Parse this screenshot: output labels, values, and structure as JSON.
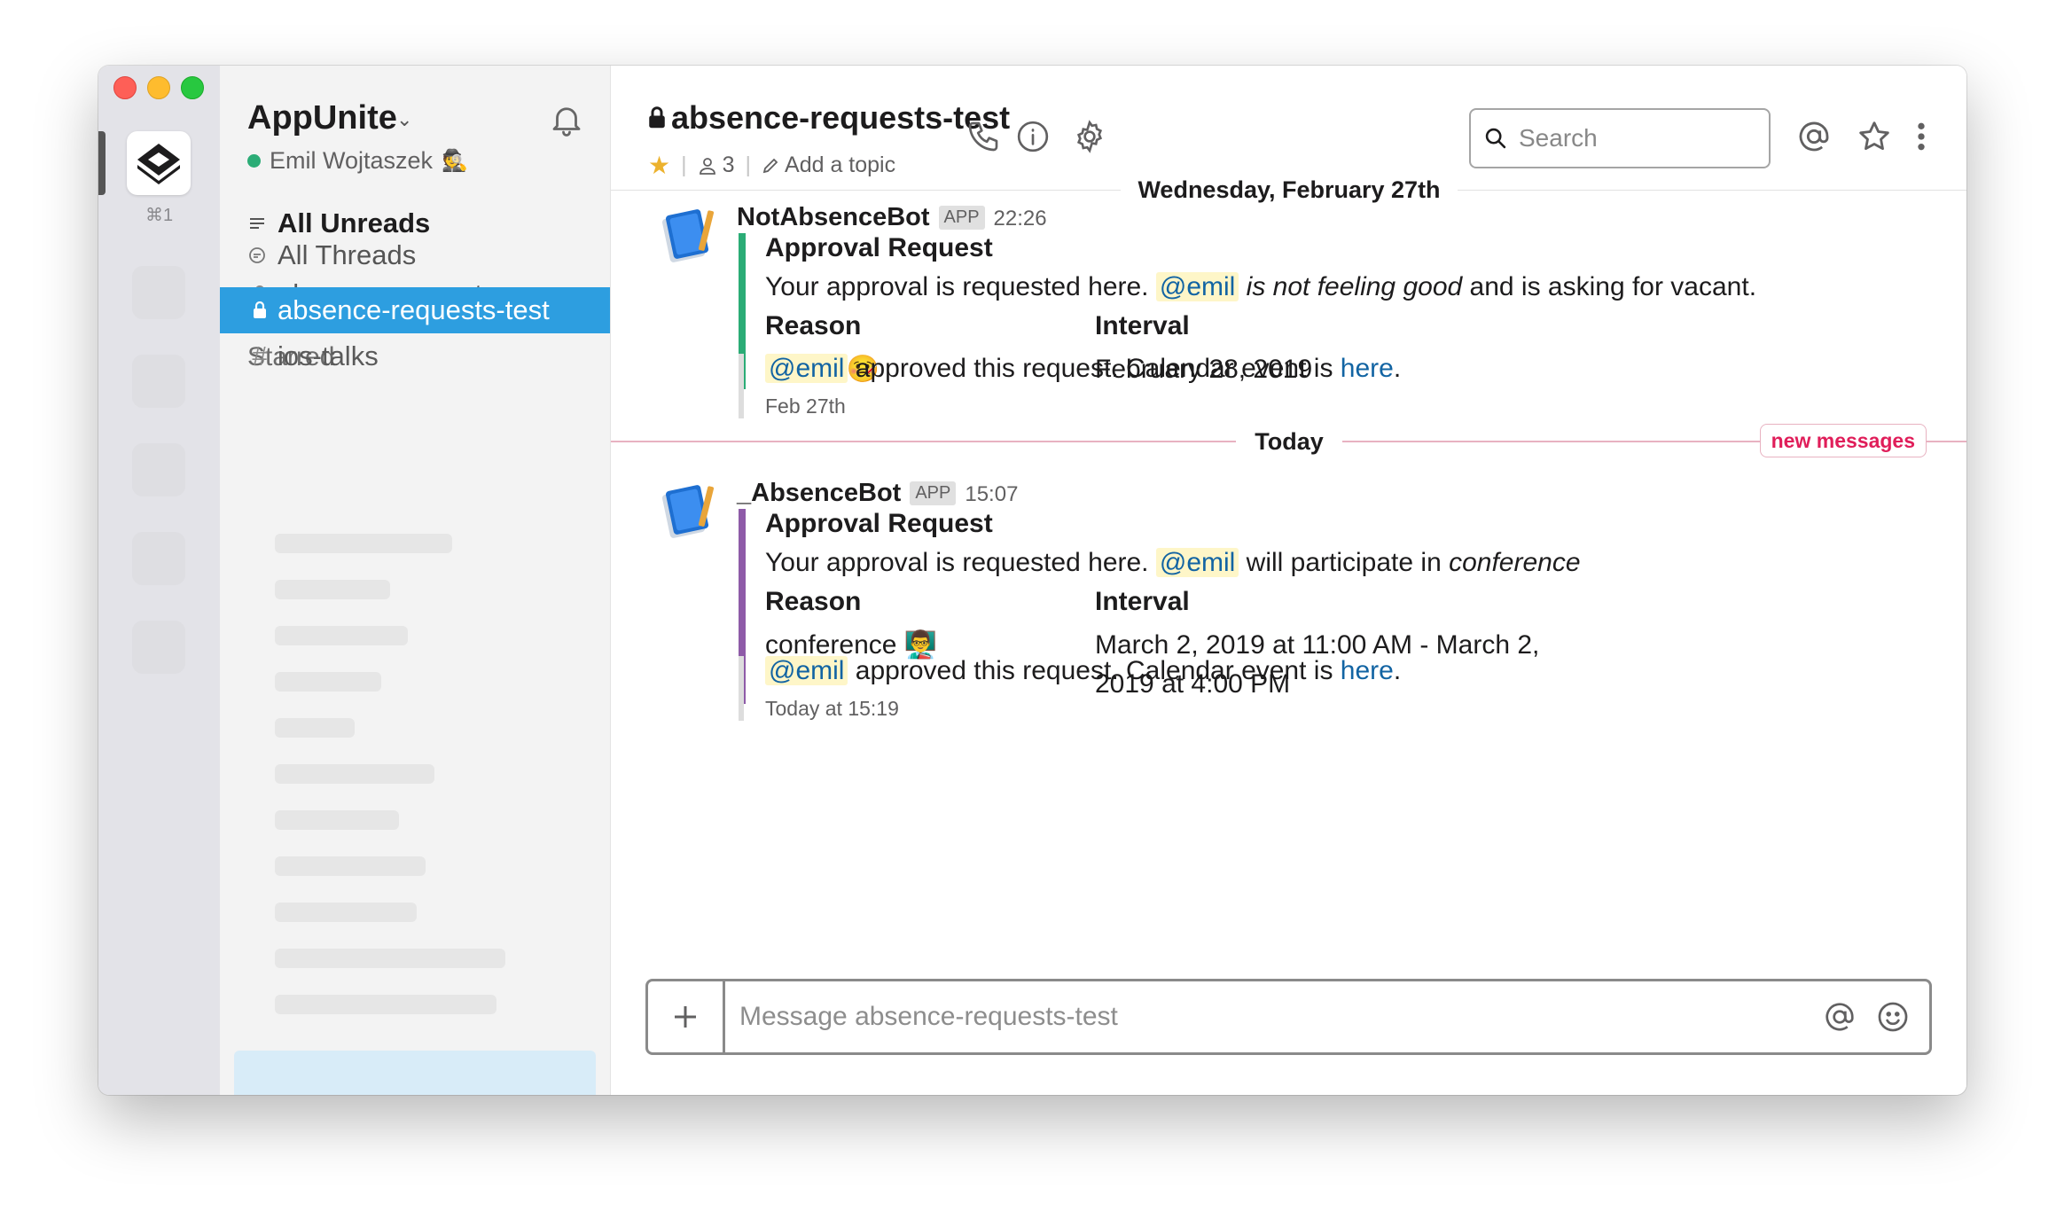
{
  "team_switcher": {
    "shortcut": "⌘1"
  },
  "sidebar": {
    "workspace_name": "AppUnite",
    "user_name": "Emil Wojtaszek",
    "user_status_emoji": "🕵️",
    "nav": [
      {
        "label": "All Unreads",
        "icon": "unreads-icon"
      },
      {
        "label": "All Threads",
        "icon": "threads-icon"
      }
    ],
    "starred_label": "Starred",
    "channels": [
      {
        "name": "absence-requests",
        "private": true,
        "active": false
      },
      {
        "name": "absence-requests-test",
        "private": true,
        "active": true
      },
      {
        "name": "ios-talks",
        "private": false,
        "active": false
      }
    ]
  },
  "header": {
    "channel_name": "absence-requests-test",
    "member_count": "3",
    "add_topic": "Add a topic",
    "search_placeholder": "Search"
  },
  "messages": [
    {
      "date_divider": "Wednesday, February 27th",
      "sender": "NotAbsenceBot",
      "badge": "APP",
      "time": "22:26",
      "accent": "#2bac76",
      "title": "Approval Request",
      "text_before": "Your approval is requested here. ",
      "mention": "@emil",
      "text_italic": "is not feeling good",
      "text_after": " and is asking for vacant.",
      "reason_label": "Reason",
      "reason_value": "illness",
      "reason_emoji": "🤒",
      "interval_label": "Interval",
      "interval_value": "February 28, 2019",
      "followup": {
        "mention": "@emil",
        "text": " approved this request. Calendar event is ",
        "link": "here",
        "end": ".",
        "time": "Feb 27th"
      }
    },
    {
      "sender": "_AbsenceBot",
      "badge": "APP",
      "time": "15:07",
      "accent": "#8e5ba8",
      "title": "Approval Request",
      "text_before": "Your approval is requested here. ",
      "mention": "@emil",
      "text_mid": " will participate in ",
      "text_italic": "conference",
      "reason_label": "Reason",
      "reason_value": "conference",
      "reason_emoji": "👨‍🏫",
      "interval_label": "Interval",
      "interval_line1": "March 2, 2019 at 11:00 AM - March 2,",
      "interval_line2": "2019 at 4:00 PM",
      "followup": {
        "mention": "@emil",
        "text": " approved this request. Calendar event is ",
        "link": "here",
        "end": ".",
        "time": "Today at 15:19"
      }
    }
  ],
  "divider": {
    "label": "Today",
    "new_messages": "new messages"
  },
  "composer": {
    "placeholder": "Message absence-requests-test"
  },
  "colors": {
    "active_channel": "#2d9ee0",
    "mention_bg": "#fef6c8",
    "link": "#1264a3",
    "new_messages": "#e01e5a"
  }
}
